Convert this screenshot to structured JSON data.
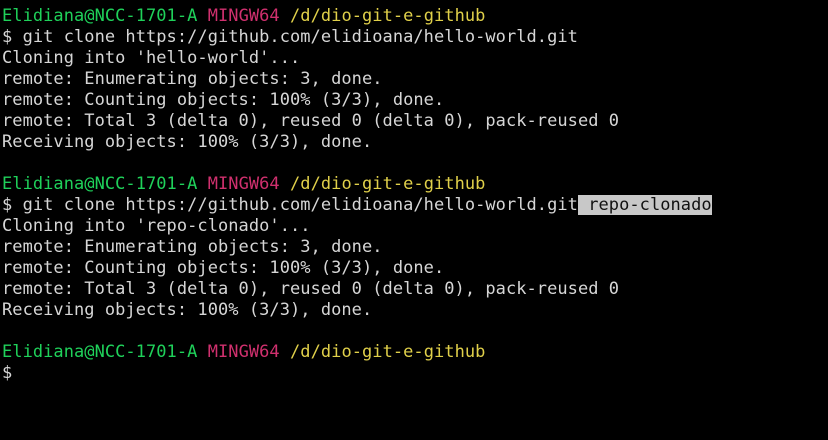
{
  "prompt": {
    "user": "Elidiana@NCC-1701-A",
    "system": "MINGW64",
    "path": "/d/dio-git-e-github"
  },
  "blocks": [
    {
      "command": "$ git clone https://github.com/elidioana/hello-world.git",
      "command_selected": "",
      "output": [
        "Cloning into 'hello-world'...",
        "remote: Enumerating objects: 3, done.",
        "remote: Counting objects: 100% (3/3), done.",
        "remote: Total 3 (delta 0), reused 0 (delta 0), pack-reused 0",
        "Receiving objects: 100% (3/3), done."
      ]
    },
    {
      "command": "$ git clone https://github.com/elidioana/hello-world.git",
      "command_selected": " repo-clonado",
      "output": [
        "Cloning into 'repo-clonado'...",
        "remote: Enumerating objects: 3, done.",
        "remote: Counting objects: 100% (3/3), done.",
        "remote: Total 3 (delta 0), reused 0 (delta 0), pack-reused 0",
        "Receiving objects: 100% (3/3), done."
      ]
    }
  ],
  "current_prompt": "$",
  "colors": {
    "user": "#1fd15a",
    "system": "#d0306e",
    "path": "#e0d04a",
    "text": "#d6d6d6",
    "background": "#000000"
  }
}
